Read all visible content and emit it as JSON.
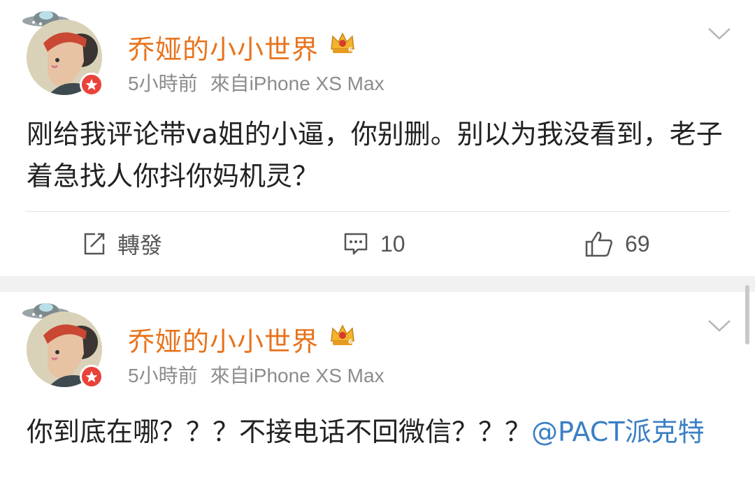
{
  "posts": [
    {
      "username": "乔娅的小小世界",
      "time": "5小時前",
      "source": "來自iPhone XS Max",
      "content": "刚给我评论带va姐的小逼，你别删。别以为我没看到，老子着急找人你抖你妈机灵？",
      "actions": {
        "share_label": "轉發",
        "comment_count": "10",
        "like_count": "69"
      }
    },
    {
      "username": "乔娅的小小世界",
      "time": "5小時前",
      "source": "來自iPhone XS Max",
      "content": "你到底在哪？？？不接电话不回微信？？？",
      "mention": "@PACT派克特"
    }
  ],
  "icons": {
    "ufo": "ufo-icon",
    "crown": "crown-vip-icon",
    "verified": "verified-badge-icon",
    "chevron": "chevron-down-icon",
    "share": "share-icon",
    "comment": "comment-icon",
    "like": "thumbs-up-icon"
  },
  "colors": {
    "username": "#e8731c",
    "mention": "#3b7fc4",
    "badge": "#e8423a"
  }
}
